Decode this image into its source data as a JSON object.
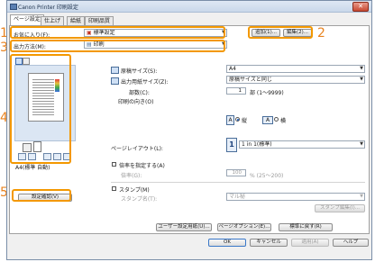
{
  "window": {
    "title": "Canon Printer 印刷設定",
    "close_label": "✕"
  },
  "tabs": [
    "ページ設定",
    "仕上げ",
    "給紙",
    "印刷品質"
  ],
  "favorites": {
    "label": "お気に入り(F):",
    "value": "標準設定",
    "add_label": "追加(1)...",
    "edit_label": "編集(2)..."
  },
  "output": {
    "label": "出力方法(M):",
    "value": "印刷"
  },
  "preview": {
    "caption": "A4(標準 自動)",
    "settings_button": "設定確認(V)"
  },
  "paper": {
    "original_size_label": "原稿サイズ(S):",
    "original_size_value": "A4",
    "output_size_label": "出力用紙サイズ(Z):",
    "output_size_value": "原稿サイズと同じ",
    "copies_label": "部数(C):",
    "copies_value": "1",
    "copies_range": "部 (1〜9999)",
    "orientation_label": "印刷の向き(O)",
    "portrait_label": "縦",
    "landscape_label": "横"
  },
  "layout": {
    "label": "ページレイアウト(L):",
    "value": "1 in 1(標準)",
    "icon_num": "1"
  },
  "scaling": {
    "label": "倍率を指定する(A)",
    "ratio_label": "倍率(G):",
    "ratio_value": "100",
    "ratio_range": "% (25〜200)"
  },
  "stamp": {
    "label": "スタンプ(M)",
    "name_label": "スタンプ名(T):",
    "name_value": "マル秘",
    "edit_label": "スタンプ編集(I)..."
  },
  "bottom": {
    "user_paper": "ユーザー設定用紙(U)...",
    "page_options": "ページオプション(E)...",
    "restore": "標準に戻す(R)"
  },
  "dialog": {
    "ok": "OK",
    "cancel": "キャンセル",
    "apply": "適用(A)",
    "help": "ヘルプ"
  },
  "callouts": [
    "1",
    "2",
    "3",
    "4",
    "5"
  ],
  "colors": {
    "callout": "#f39800",
    "callout_text": "#e8821e",
    "accent": "#1a5bb8"
  }
}
